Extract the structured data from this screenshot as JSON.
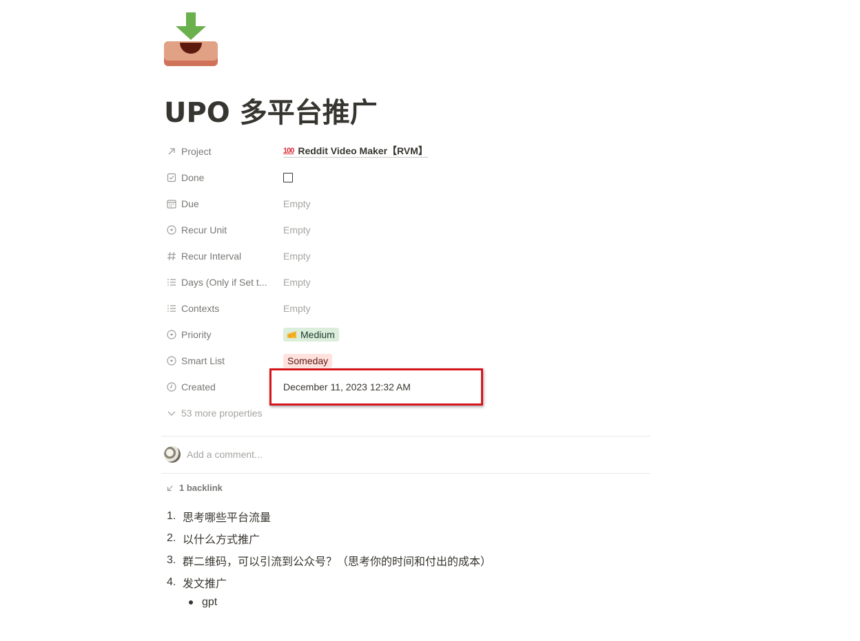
{
  "page": {
    "icon": "inbox-download-icon",
    "title": "UPO 多平台推广"
  },
  "properties": [
    {
      "name": "Project",
      "icon": "arrow-up-right-icon",
      "type": "relation",
      "value": "Reddit Video Maker【RVM】",
      "value_icon": "100-emoji",
      "value_icon_text": "100"
    },
    {
      "name": "Done",
      "icon": "checkbox-icon",
      "type": "checkbox",
      "checked": false
    },
    {
      "name": "Due",
      "icon": "calendar-icon",
      "type": "date",
      "value": "Empty"
    },
    {
      "name": "Recur Unit",
      "icon": "select-icon",
      "type": "select",
      "value": "Empty"
    },
    {
      "name": "Recur Interval",
      "icon": "hash-icon",
      "type": "number",
      "value": "Empty"
    },
    {
      "name": "Days (Only if Set t...",
      "icon": "list-icon",
      "type": "multi-select",
      "value": "Empty"
    },
    {
      "name": "Contexts",
      "icon": "list-icon",
      "type": "multi-select",
      "value": "Empty"
    },
    {
      "name": "Priority",
      "icon": "select-icon",
      "type": "select",
      "value": "Medium",
      "tag_color": "#dbeddb",
      "tag_icon": "cheese-emoji"
    },
    {
      "name": "Smart List",
      "icon": "select-icon",
      "type": "select",
      "value": "Someday",
      "tag_color": "#ffe2dd"
    },
    {
      "name": "Created",
      "icon": "clock-icon",
      "type": "created-time",
      "value": "December 11, 2023 12:32 AM"
    }
  ],
  "more_properties": "53 more properties",
  "comment": {
    "placeholder": "Add a comment..."
  },
  "backlinks": {
    "label": "1 backlink"
  },
  "content": {
    "numbered": [
      {
        "num": "1.",
        "text": "思考哪些平台流量"
      },
      {
        "num": "2.",
        "text": "以什么方式推广"
      },
      {
        "num": "3.",
        "text": "群二维码，可以引流到公众号？（思考你的时间和付出的成本）"
      },
      {
        "num": "4.",
        "text": "发文推广"
      }
    ],
    "bullets": [
      "gpt"
    ]
  },
  "colors": {
    "text": "#37352f",
    "muted": "#787774",
    "placeholder": "#a5a4a0",
    "highlight_border": "#d6141b"
  }
}
